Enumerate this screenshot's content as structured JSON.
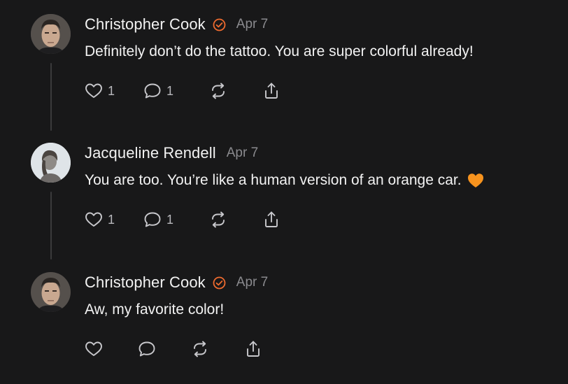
{
  "colors": {
    "background": "#181819",
    "text": "#f2f2f2",
    "muted": "#8a8a8e",
    "accent_orange": "#ee6b2f",
    "thread_line": "#3a3a3c",
    "icon": "#c8c8cc"
  },
  "posts": [
    {
      "author": "Christopher Cook",
      "verified": true,
      "date": "Apr 7",
      "text": "Definitely don’t do the tattoo. You are super colorful already!",
      "emoji": null,
      "likes": "1",
      "replies": "1",
      "icons": [
        "heart-icon",
        "comment-icon",
        "repost-icon",
        "share-icon"
      ]
    },
    {
      "author": "Jacqueline Rendell",
      "verified": false,
      "date": "Apr 7",
      "text": "You are too. You’re like a human version of an orange car.",
      "emoji": "orange-heart-emoji",
      "likes": "1",
      "replies": "1",
      "icons": [
        "heart-icon",
        "comment-icon",
        "repost-icon",
        "share-icon"
      ]
    },
    {
      "author": "Christopher Cook",
      "verified": true,
      "date": "Apr 7",
      "text": "Aw, my favorite color!",
      "emoji": null,
      "likes": "",
      "replies": "",
      "icons": [
        "heart-icon",
        "comment-icon",
        "repost-icon",
        "share-icon"
      ]
    }
  ]
}
